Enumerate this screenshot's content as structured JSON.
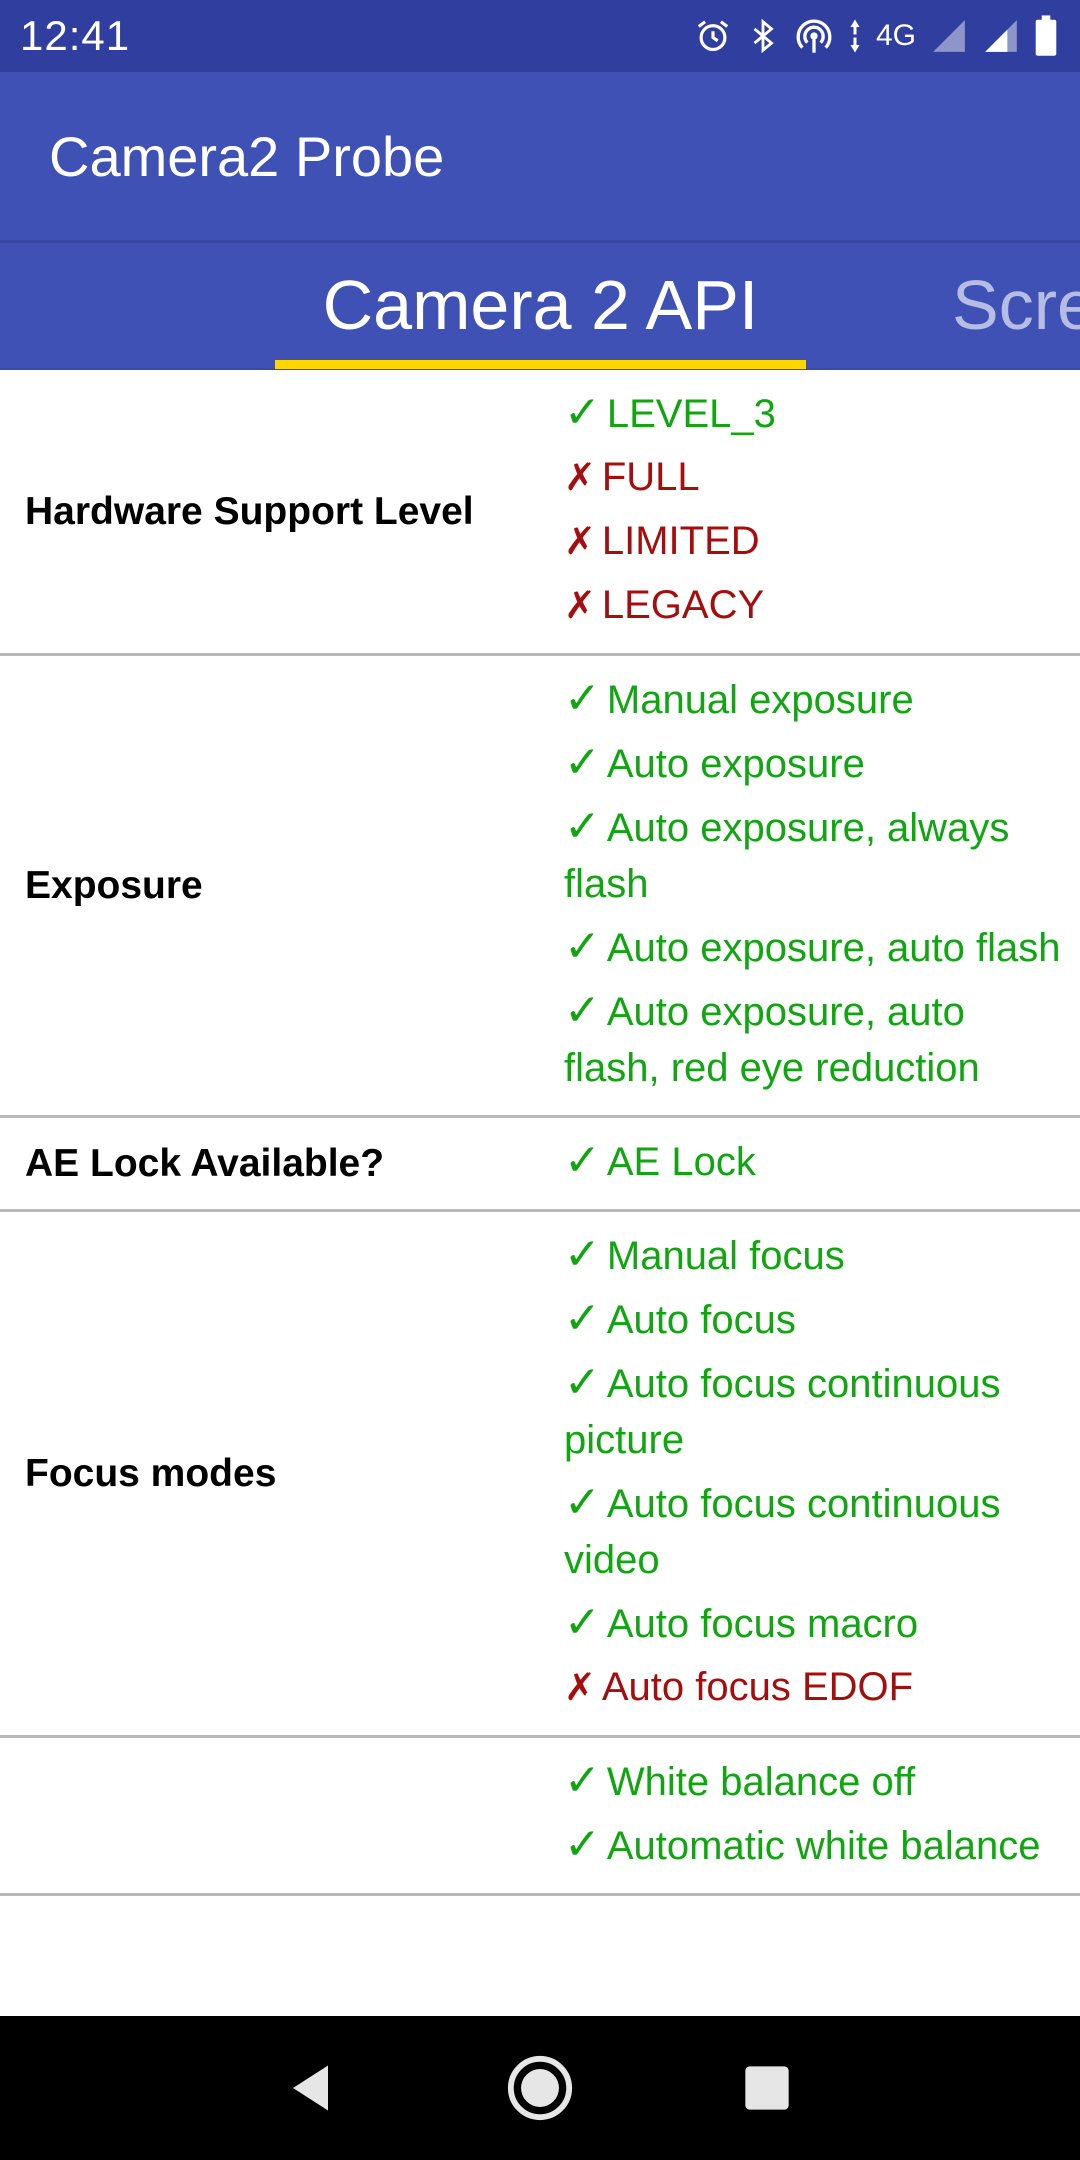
{
  "status_bar": {
    "time": "12:41",
    "network": "4G",
    "icons": [
      "alarm-icon",
      "bluetooth-icon",
      "hotspot-icon",
      "data-arrows-icon",
      "signal-icon",
      "signal-icon",
      "battery-icon"
    ]
  },
  "app_bar": {
    "title": "Camera2 Probe"
  },
  "tabs": [
    {
      "label": "Camera 2 API",
      "active": true
    },
    {
      "label": "Scre",
      "active": false
    }
  ],
  "accent_colors": {
    "primary": "#3f51b5",
    "primary_dark": "#303f9f",
    "indicator": "#ffd600",
    "supported": "#11a611",
    "unsupported": "#a50e0e"
  },
  "rows": [
    {
      "label": "Hardware Support Level",
      "values": [
        {
          "mark": "✓",
          "text": "LEVEL_3",
          "supported": true
        },
        {
          "mark": "✗",
          "text": "FULL",
          "supported": false
        },
        {
          "mark": "✗",
          "text": "LIMITED",
          "supported": false
        },
        {
          "mark": "✗",
          "text": "LEGACY",
          "supported": false
        }
      ]
    },
    {
      "label": "Exposure",
      "values": [
        {
          "mark": "✓",
          "text": "Manual exposure",
          "supported": true
        },
        {
          "mark": "✓",
          "text": "Auto exposure",
          "supported": true
        },
        {
          "mark": "✓",
          "text": "Auto exposure, always flash",
          "supported": true
        },
        {
          "mark": "✓",
          "text": "Auto exposure, auto flash",
          "supported": true
        },
        {
          "mark": "✓",
          "text": "Auto exposure, auto flash, red eye reduction",
          "supported": true
        }
      ]
    },
    {
      "label": "AE Lock Available?",
      "values": [
        {
          "mark": "✓",
          "text": "AE Lock",
          "supported": true
        }
      ]
    },
    {
      "label": "Focus modes",
      "values": [
        {
          "mark": "✓",
          "text": "Manual focus",
          "supported": true
        },
        {
          "mark": "✓",
          "text": "Auto focus",
          "supported": true
        },
        {
          "mark": "✓",
          "text": "Auto focus continuous picture",
          "supported": true
        },
        {
          "mark": "✓",
          "text": "Auto focus continuous video",
          "supported": true
        },
        {
          "mark": "✓",
          "text": "Auto focus macro",
          "supported": true
        },
        {
          "mark": "✗",
          "text": "Auto focus EDOF",
          "supported": false
        }
      ]
    },
    {
      "label": "",
      "values": [
        {
          "mark": "✓",
          "text": "White balance off",
          "supported": true
        },
        {
          "mark": "✓",
          "text": "Automatic white balance",
          "supported": true
        }
      ]
    }
  ],
  "nav_bar": {
    "buttons": [
      "back-icon",
      "home-icon",
      "recents-icon"
    ]
  }
}
